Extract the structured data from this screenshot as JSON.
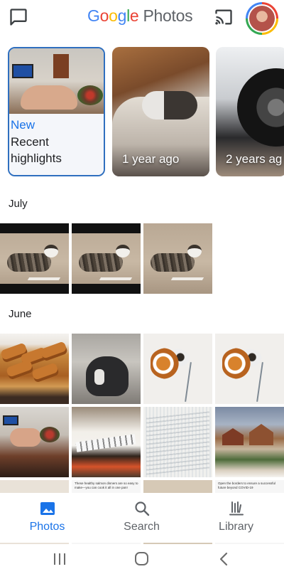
{
  "app": {
    "brand_google": [
      "G",
      "o",
      "o",
      "g",
      "l",
      "e"
    ],
    "brand_google_colors": [
      "#4285f4",
      "#ea4335",
      "#fbbc05",
      "#4285f4",
      "#34a853",
      "#ea4335"
    ],
    "brand_photos": "Photos"
  },
  "memories": {
    "highlight": {
      "badge": "New",
      "title": "Recent highlights"
    },
    "cards": [
      {
        "caption": "1 year ago"
      },
      {
        "caption": "2 years ag"
      }
    ]
  },
  "sections": [
    {
      "label": "July"
    },
    {
      "label": "June"
    }
  ],
  "captions": {
    "june_food": "These healthy salmon dinners are so easy to make—you can cook it all in one pan!",
    "june_village": "Open the borders to ensure a successful future beyond COVID-19"
  },
  "bottom_nav": {
    "items": [
      {
        "label": "Photos",
        "icon": "photos-icon",
        "active": true
      },
      {
        "label": "Search",
        "icon": "search-icon",
        "active": false
      },
      {
        "label": "Library",
        "icon": "library-icon",
        "active": false
      }
    ]
  },
  "colors": {
    "accent": "#1a73e8",
    "highlight_border": "#2f6fbf",
    "text_primary": "#202124",
    "text_secondary": "#5f6368"
  }
}
